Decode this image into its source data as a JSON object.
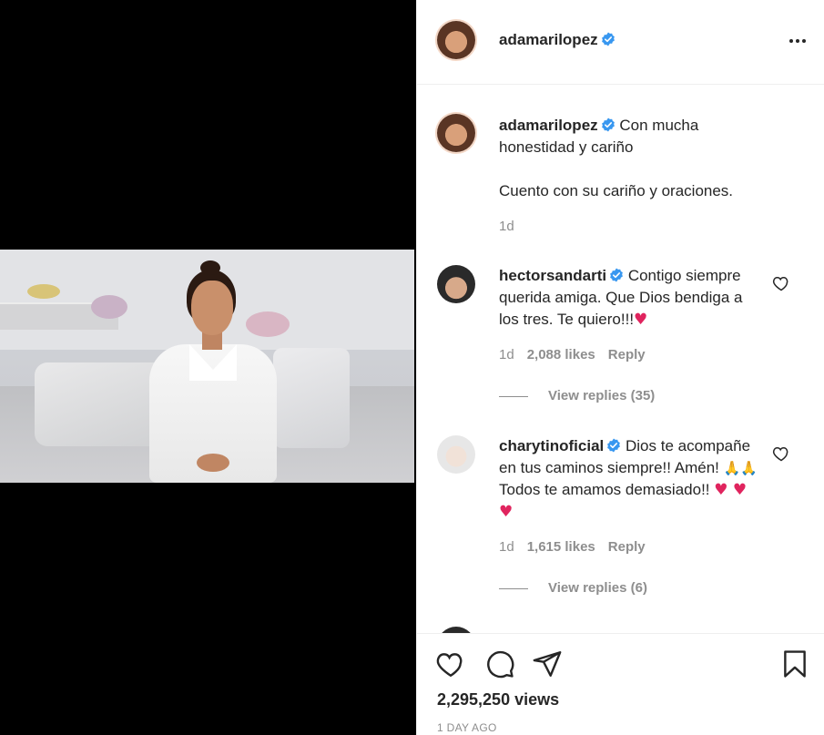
{
  "post": {
    "author": "adamarilopez",
    "verified": true
  },
  "caption": {
    "username": "adamarilopez",
    "text_line1": "Con mucha honestidad y cariño",
    "text_line2": "Cuento con su cariño y oraciones.",
    "time": "1d"
  },
  "comments": [
    {
      "username": "hectorsandarti",
      "text": "Contigo siempre querida amiga. Que Dios bendiga a los tres. Te quiero!!!",
      "emoji": "♥",
      "time": "1d",
      "likes": "2,088 likes",
      "reply": "Reply",
      "view_replies": "View replies (35)"
    },
    {
      "username": "charytinoficial",
      "text_a": "Dios te acompañe en tus caminos siempre!! Amén!",
      "emoji_a": "🙏🙏",
      "text_b": "Todos te amamos demasiado!!",
      "emoji_b": "♥ ♥ ♥",
      "time": "1d",
      "likes": "1,615 likes",
      "reply": "Reply",
      "view_replies": "View replies (6)"
    }
  ],
  "stats": {
    "views": "2,295,250 views",
    "posted": "1 DAY AGO"
  },
  "icons": {
    "more": "more-options-icon",
    "verified": "verified-badge-icon",
    "like": "heart-icon",
    "comment": "comment-icon",
    "share": "share-icon",
    "save": "bookmark-icon"
  },
  "colors": {
    "verified": "#3897f0",
    "heart": "#e0245e",
    "text": "#262626",
    "muted": "#8e8e8e"
  }
}
